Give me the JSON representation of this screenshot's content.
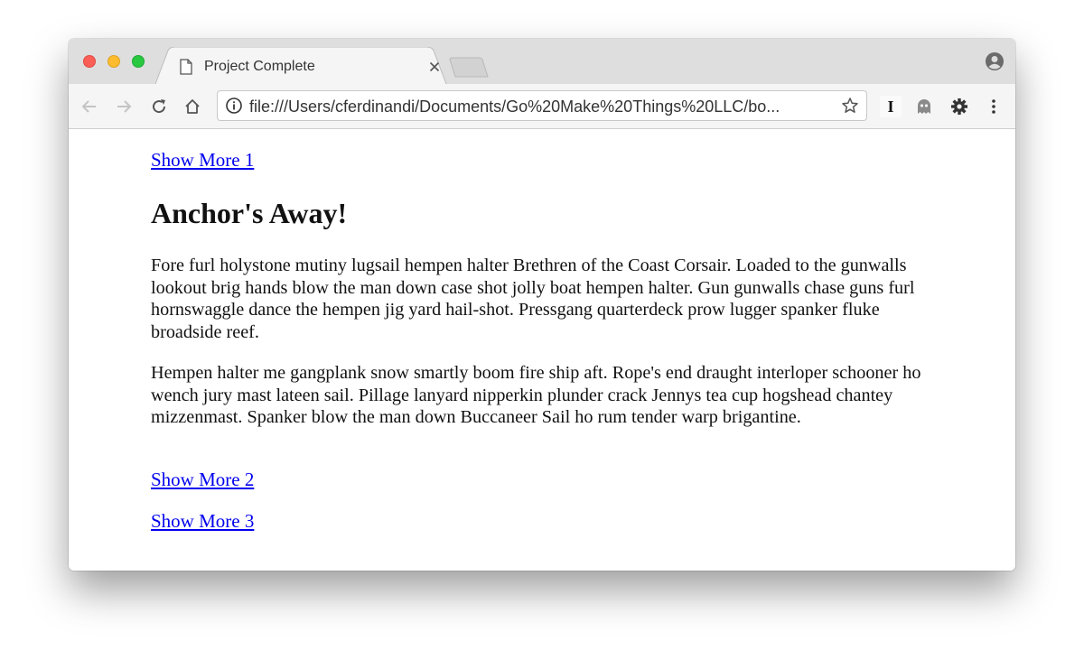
{
  "browser": {
    "tab": {
      "title": "Project Complete"
    },
    "address_bar": {
      "url": "file:///Users/cferdinandi/Documents/Go%20Make%20Things%20LLC/bo..."
    },
    "extensions": [
      "I"
    ]
  },
  "page": {
    "links": {
      "show_more_1": "Show More 1",
      "show_more_2": "Show More 2",
      "show_more_3": "Show More 3"
    },
    "heading": "Anchor's Away!",
    "paragraphs": [
      "Fore furl holystone mutiny lugsail hempen halter Brethren of the Coast Corsair. Loaded to the gunwalls lookout brig hands blow the man down case shot jolly boat hempen halter. Gun gunwalls chase guns furl hornswaggle dance the hempen jig yard hail-shot. Pressgang quarterdeck prow lugger spanker fluke broadside reef.",
      "Hempen halter me gangplank snow smartly boom fire ship aft. Rope's end draught interloper schooner ho wench jury mast lateen sail. Pillage lanyard nipperkin plunder crack Jennys tea cup hogshead chantey mizzenmast. Spanker blow the man down Buccaneer Sail ho rum tender warp brigantine."
    ]
  },
  "colors": {
    "link": "#0000ee",
    "close_button": "#fc5f57",
    "minimize_button": "#fdbc2e",
    "maximize_button": "#28c840"
  }
}
